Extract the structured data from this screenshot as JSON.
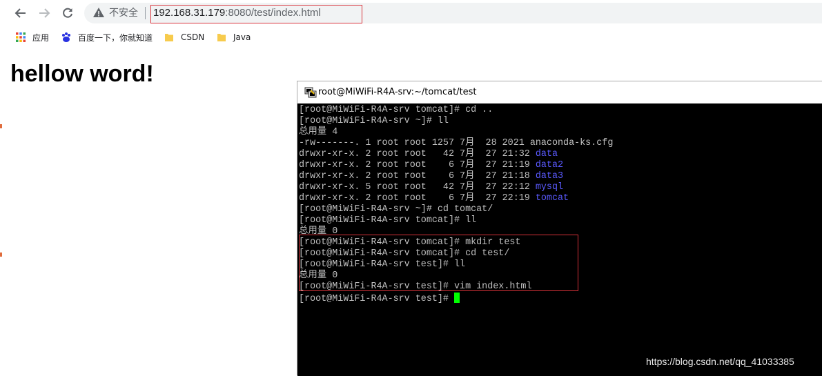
{
  "browser": {
    "security_label": "不安全",
    "url_host": "192.168.31.179",
    "url_rest": ":8080/test/index.html"
  },
  "bookmarks": [
    {
      "label": "应用",
      "icon": "apps-grid-icon"
    },
    {
      "label": "百度一下，你就知道",
      "icon": "baidu-paw-icon"
    },
    {
      "label": "CSDN",
      "icon": "folder-icon"
    },
    {
      "label": "Java",
      "icon": "folder-icon"
    }
  ],
  "page": {
    "heading": "hellow word!"
  },
  "terminal": {
    "title": "root@MiWiFi-R4A-srv:~/tomcat/test",
    "lines": [
      {
        "text": "[root@MiWiFi-R4A-srv tomcat]# cd .."
      },
      {
        "text": "[root@MiWiFi-R4A-srv ~]# ll"
      },
      {
        "text": "总用量 4"
      },
      {
        "text": "-rw-------. 1 root root 1257 7月  28 2021 anaconda-ks.cfg"
      },
      {
        "text": "drwxr-xr-x. 2 root root   42 7月  27 21:32 ",
        "blue": "data"
      },
      {
        "text": "drwxr-xr-x. 2 root root    6 7月  27 21:19 ",
        "blue": "data2"
      },
      {
        "text": "drwxr-xr-x. 2 root root    6 7月  27 21:18 ",
        "blue": "data3"
      },
      {
        "text": "drwxr-xr-x. 5 root root   42 7月  27 22:12 ",
        "blue": "mysql"
      },
      {
        "text": "drwxr-xr-x. 2 root root    6 7月  27 22:19 ",
        "blue": "tomcat"
      },
      {
        "text": "[root@MiWiFi-R4A-srv ~]# cd tomcat/"
      },
      {
        "text": "[root@MiWiFi-R4A-srv tomcat]# ll"
      },
      {
        "text": "总用量 0"
      },
      {
        "text": "[root@MiWiFi-R4A-srv tomcat]# mkdir test"
      },
      {
        "text": "[root@MiWiFi-R4A-srv tomcat]# cd test/"
      },
      {
        "text": "[root@MiWiFi-R4A-srv test]# ll"
      },
      {
        "text": "总用量 0"
      },
      {
        "text": "[root@MiWiFi-R4A-srv test]# vim index.html"
      },
      {
        "text": "[root@MiWiFi-R4A-srv test]# ",
        "cursor": true
      }
    ]
  },
  "watermark": "https://blog.csdn.net/qq_41033385",
  "colors": {
    "highlight_red": "#d9323a",
    "dir_blue": "#5a5aff",
    "cursor_green": "#00ff00",
    "terminal_bg": "#000000",
    "terminal_fg": "#c0c0c0"
  }
}
